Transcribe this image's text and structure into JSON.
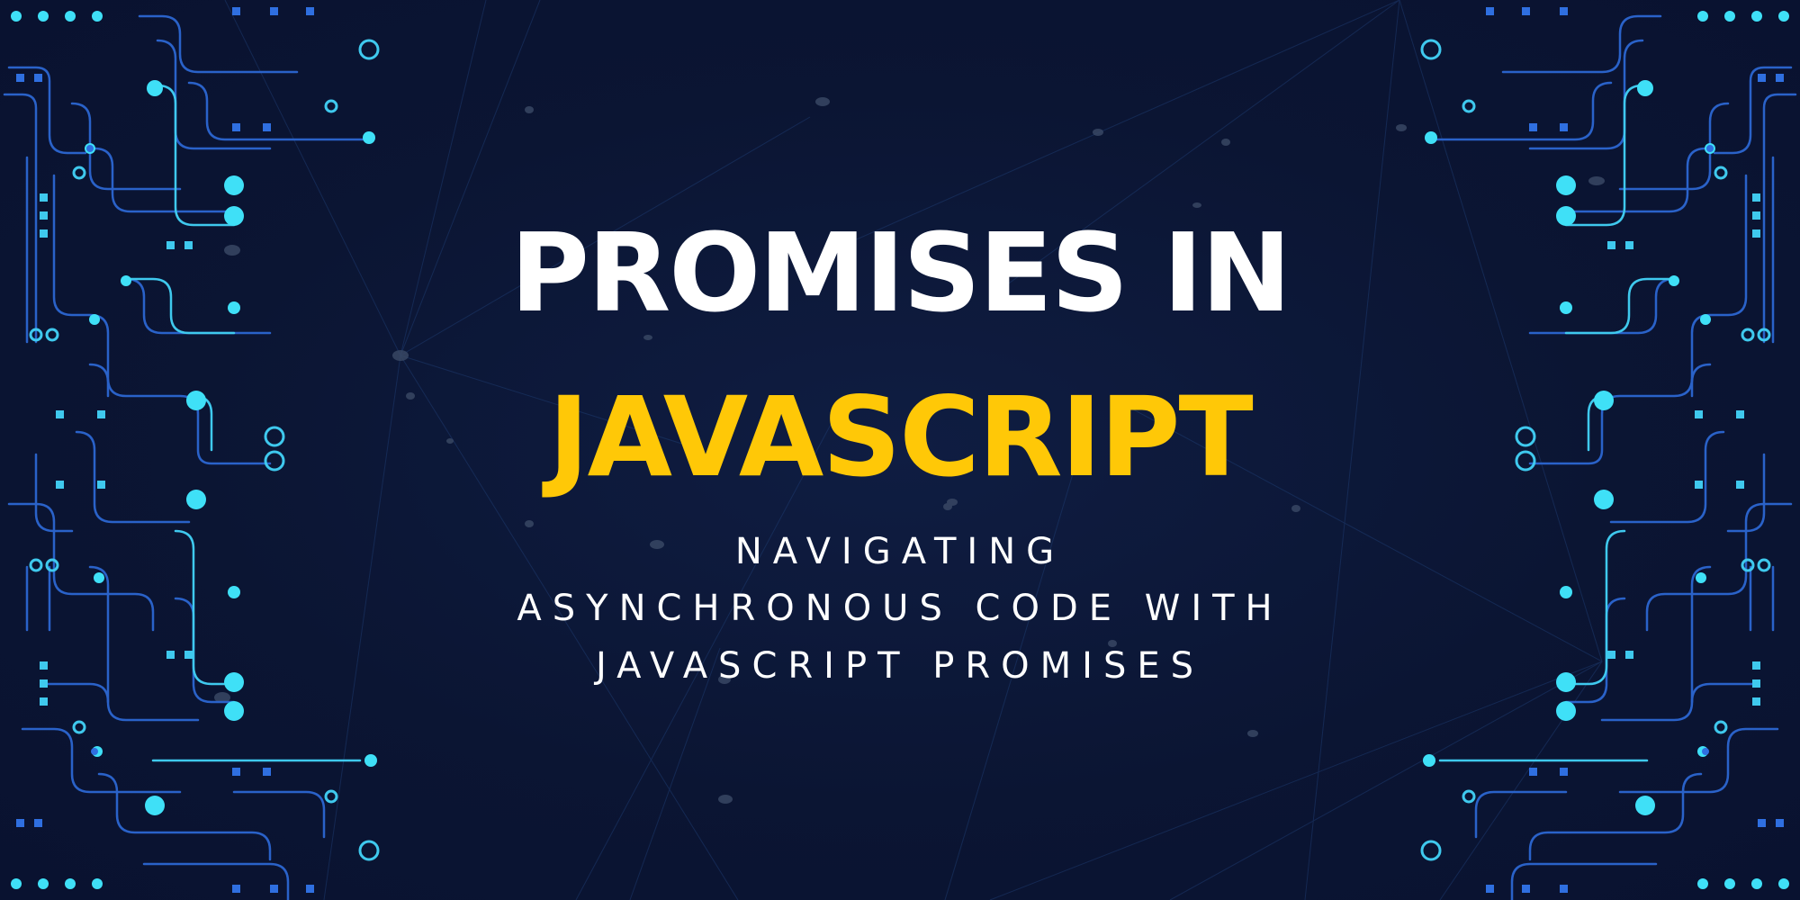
{
  "title": {
    "line1": "PROMISES IN",
    "line2": "JAVASCRIPT"
  },
  "subtitle": {
    "line1": "NAVIGATING",
    "line2": "ASYNCHRONOUS CODE WITH",
    "line3": "JAVASCRIPT PROMISES"
  },
  "colors": {
    "background": "#0b1533",
    "title_primary": "#ffffff",
    "title_accent": "#ffc807",
    "circuit_cyan": "#39e0f5",
    "circuit_blue": "#2f6fe0"
  },
  "decoration": {
    "left": "circuit-board-pattern",
    "right": "circuit-board-pattern",
    "center": "network-lines-pattern"
  }
}
